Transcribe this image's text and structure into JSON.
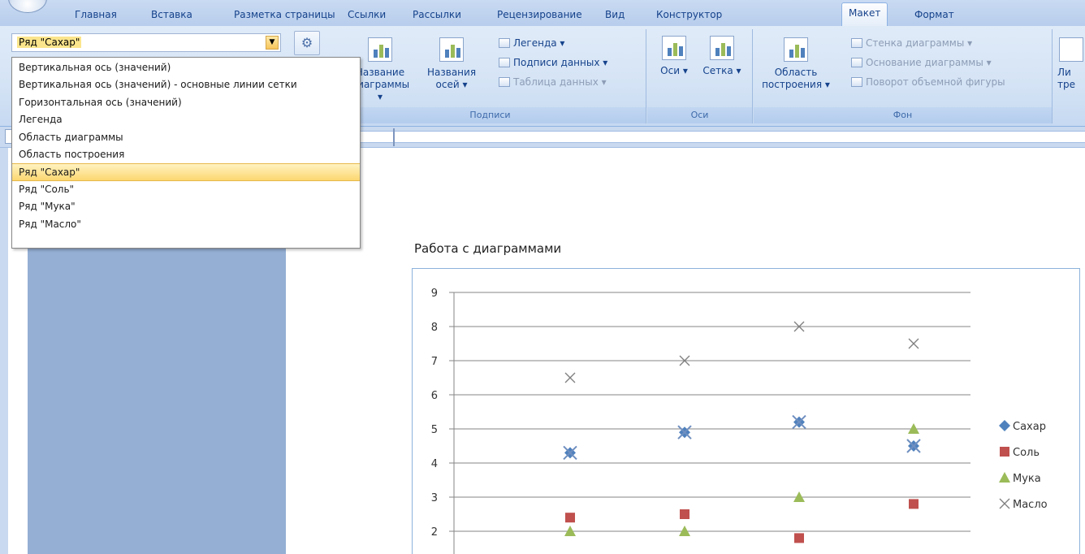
{
  "tabs": [
    "Главная",
    "Вставка",
    "Разметка страницы",
    "Ссылки",
    "Рассылки",
    "Рецензирование",
    "Вид",
    "Конструктор",
    "Макет",
    "Формат"
  ],
  "active_tab": "Макет",
  "selector": {
    "value": "Ряд \"Сахар\""
  },
  "ribbon": {
    "chart_title": "Название диаграммы ▾",
    "axis_titles": "Названия осей ▾",
    "legend": "Легенда ▾",
    "data_labels": "Подписи данных ▾",
    "data_table": "Таблица данных ▾",
    "labels_group": "Подписи",
    "axes": "Оси ▾",
    "gridlines": "Сетка ▾",
    "axes_group": "Оси",
    "plot_area": "Область построения ▾",
    "chart_wall": "Стенка диаграммы ▾",
    "chart_floor": "Основание диаграммы ▾",
    "rotation": "Поворот объемной фигуры",
    "background_group": "Фон",
    "trendline": "Ли тре"
  },
  "dropdown_items": [
    "Вертикальная ось (значений)",
    "Вертикальная ось (значений) - основные линии сетки",
    "Горизонтальная ось (значений)",
    "Легенда",
    "Область диаграммы",
    "Область построения",
    "Ряд \"Сахар\"",
    "Ряд \"Соль\"",
    "Ряд \"Мука\"",
    "Ряд \"Масло\""
  ],
  "selected_dropdown_index": 6,
  "document": {
    "title": "Работа с диаграммами"
  },
  "colors": {
    "sugar": "#4f81bd",
    "salt": "#c0504d",
    "flour": "#9bbb59",
    "butter": "#7f7f7f",
    "gridline": "#868686"
  },
  "chart_data": {
    "type": "scatter",
    "title": "",
    "xlabel": "",
    "ylabel": "",
    "ylim": [
      2,
      9
    ],
    "yticks": [
      9,
      8,
      7,
      6,
      5,
      4,
      3,
      2
    ],
    "x": [
      1,
      2,
      3,
      4
    ],
    "legend_position": "right",
    "grid": true,
    "series": [
      {
        "name": "Сахар",
        "marker": "diamond",
        "values": [
          4.3,
          4.9,
          5.2,
          4.5
        ]
      },
      {
        "name": "Соль",
        "marker": "square",
        "values": [
          2.4,
          2.5,
          1.8,
          2.8
        ]
      },
      {
        "name": "Мука",
        "marker": "triangle",
        "values": [
          2.0,
          2.0,
          3.0,
          5.0
        ]
      },
      {
        "name": "Масло",
        "marker": "x",
        "values": [
          6.5,
          7.0,
          8.0,
          7.5
        ]
      }
    ]
  }
}
